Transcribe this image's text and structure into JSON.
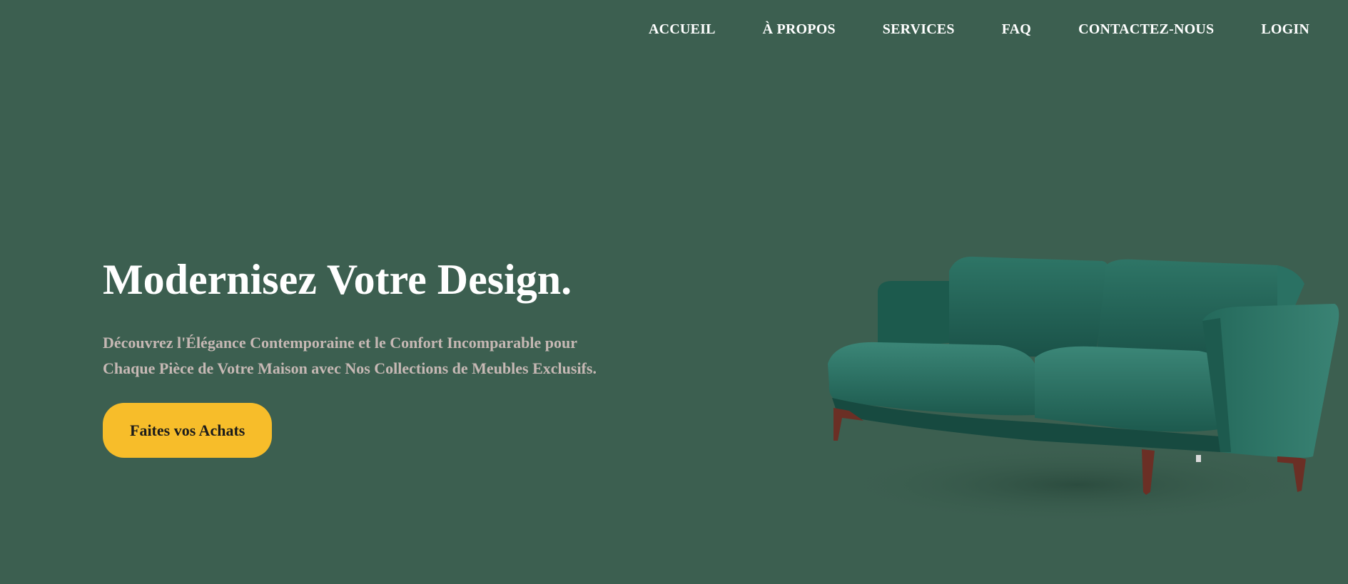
{
  "nav": {
    "items": [
      {
        "label": "ACCUEIL"
      },
      {
        "label": "À PROPOS"
      },
      {
        "label": "SERVICES"
      },
      {
        "label": "FAQ"
      },
      {
        "label": "CONTACTEZ-NOUS"
      },
      {
        "label": "LOGIN"
      }
    ]
  },
  "hero": {
    "title": "Modernisez Votre Design.",
    "subtitle_line1": "Découvrez l'Élégance Contemporaine et le Confort Incomparable pour",
    "subtitle_line2": "Chaque Pièce de Votre Maison avec Nos Collections de Meubles Exclusifs.",
    "cta_label": "Faites vos Achats"
  },
  "colors": {
    "background": "#3c5f50",
    "accent": "#f7bd2a",
    "subtitle_text": "#c6b8b4",
    "sofa_fabric": "#1f5f52"
  },
  "images": {
    "hero_image": "green-velvet-sofa"
  }
}
